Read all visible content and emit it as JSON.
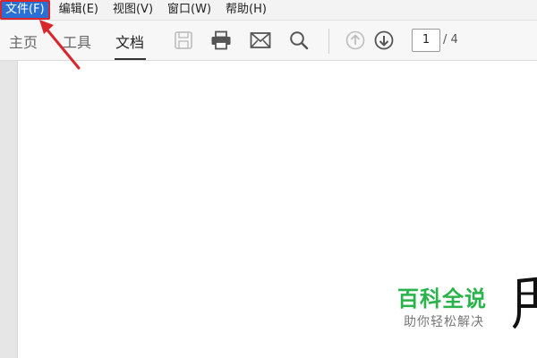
{
  "menubar": {
    "items": [
      {
        "label": "文件(F)"
      },
      {
        "label": "编辑(E)"
      },
      {
        "label": "视图(V)"
      },
      {
        "label": "窗口(W)"
      },
      {
        "label": "帮助(H)"
      }
    ]
  },
  "toolbar": {
    "tabs": [
      {
        "label": "主页"
      },
      {
        "label": "工具"
      },
      {
        "label": "文档",
        "active": true
      }
    ],
    "icons": [
      "save-icon",
      "print-icon",
      "mail-icon",
      "search-icon",
      "page-up-icon",
      "page-down-icon"
    ],
    "page_current": "1",
    "page_total": "/ 4"
  },
  "watermark": {
    "title": "百科全说",
    "subtitle": "助你轻松解决"
  },
  "colors": {
    "highlight": "#2a6fd4",
    "annotation": "#d8262c",
    "brand_green": "#29b34a"
  }
}
